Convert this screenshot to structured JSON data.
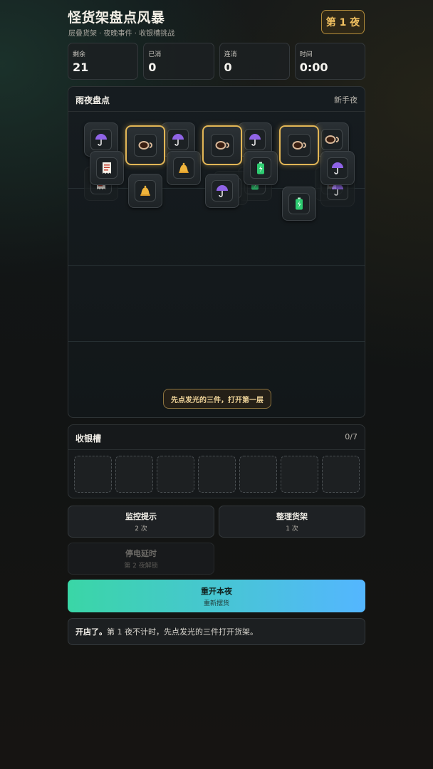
{
  "header": {
    "title": "怪货架盘点风暴",
    "subtitle": "层叠货架 · 夜晚事件 · 收银槽挑战",
    "night_badge": "第 1 夜"
  },
  "stats": [
    {
      "label": "剩余",
      "value": "21"
    },
    {
      "label": "已消",
      "value": "0"
    },
    {
      "label": "连消",
      "value": "0"
    },
    {
      "label": "时间",
      "value": "0:00"
    }
  ],
  "board": {
    "title": "雨夜盘点",
    "mode": "新手夜",
    "hint": "先点发光的三件，打开第一层"
  },
  "tiles": {
    "back": [
      "receipt-icon",
      "battery-icon",
      "receipt-icon",
      "receipt-icon",
      "umbrella-icon"
    ],
    "mid": [
      "umbrella-icon",
      "umbrella-icon",
      "umbrella-icon",
      "coffee-icon",
      "receipt-icon",
      "bell-icon",
      "battery-icon",
      "umbrella-icon",
      "bell-icon",
      "umbrella-icon",
      "battery-icon"
    ],
    "glow": [
      "coffee-icon",
      "coffee-icon",
      "coffee-icon"
    ]
  },
  "tray": {
    "title": "收银槽",
    "count": "0/7",
    "slot_count": 7
  },
  "actions": {
    "monitor_hint": {
      "label": "监控提示",
      "sub": "2 次"
    },
    "tidy_shelf": {
      "label": "整理货架",
      "sub": "1 次"
    },
    "power_delay": {
      "label": "停电延时",
      "sub": "第 2 夜解锁"
    },
    "restart": {
      "label": "重开本夜",
      "sub": "重新摆货"
    }
  },
  "log": {
    "bold": "开店了。",
    "text": "第 1 夜不计时，先点发光的三件打开货架。"
  },
  "colors": {
    "gold_accent": "#e2b656",
    "restart_gradient_start": "#3ad6a6",
    "restart_gradient_end": "#54b6ff",
    "umbrella": "#8f63e6",
    "bell": "#f0b43c",
    "battery": "#2ecc71",
    "receipt": "#c0392b",
    "coffee": "#d8b899"
  }
}
